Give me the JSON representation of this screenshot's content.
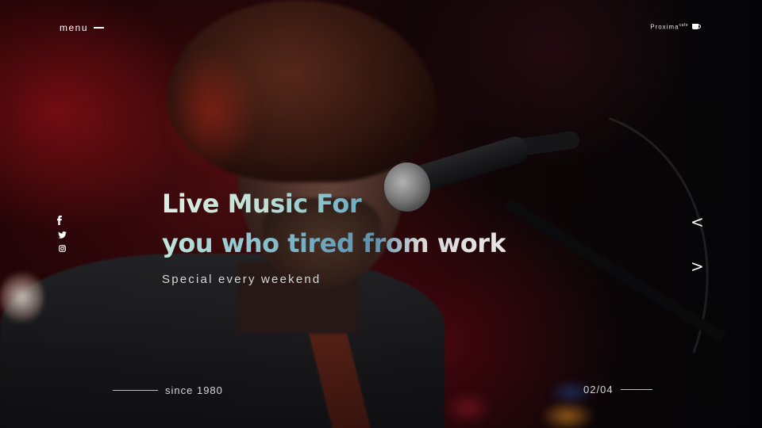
{
  "header": {
    "menu_label": "menu",
    "brand_name": "Proxima",
    "brand_sup": "cafe",
    "brand_icon": "coffee-cup-icon"
  },
  "social": [
    {
      "name": "facebook-icon"
    },
    {
      "name": "twitter-icon"
    },
    {
      "name": "instagram-icon"
    }
  ],
  "hero": {
    "headline_line1": "Live Music For",
    "headline_line2": "you who tired from work",
    "tagline": "Special every weekend"
  },
  "slider": {
    "prev_label": "<",
    "next_label": ">",
    "current": "02",
    "total": "04",
    "separator": "/"
  },
  "footer": {
    "since_text": "since 1980"
  },
  "colors": {
    "headline_gradient_start": "#dcefe6",
    "headline_gradient_accent": "#6aa7c2",
    "text_white": "#ffffff",
    "background_red": "#8a1418"
  }
}
